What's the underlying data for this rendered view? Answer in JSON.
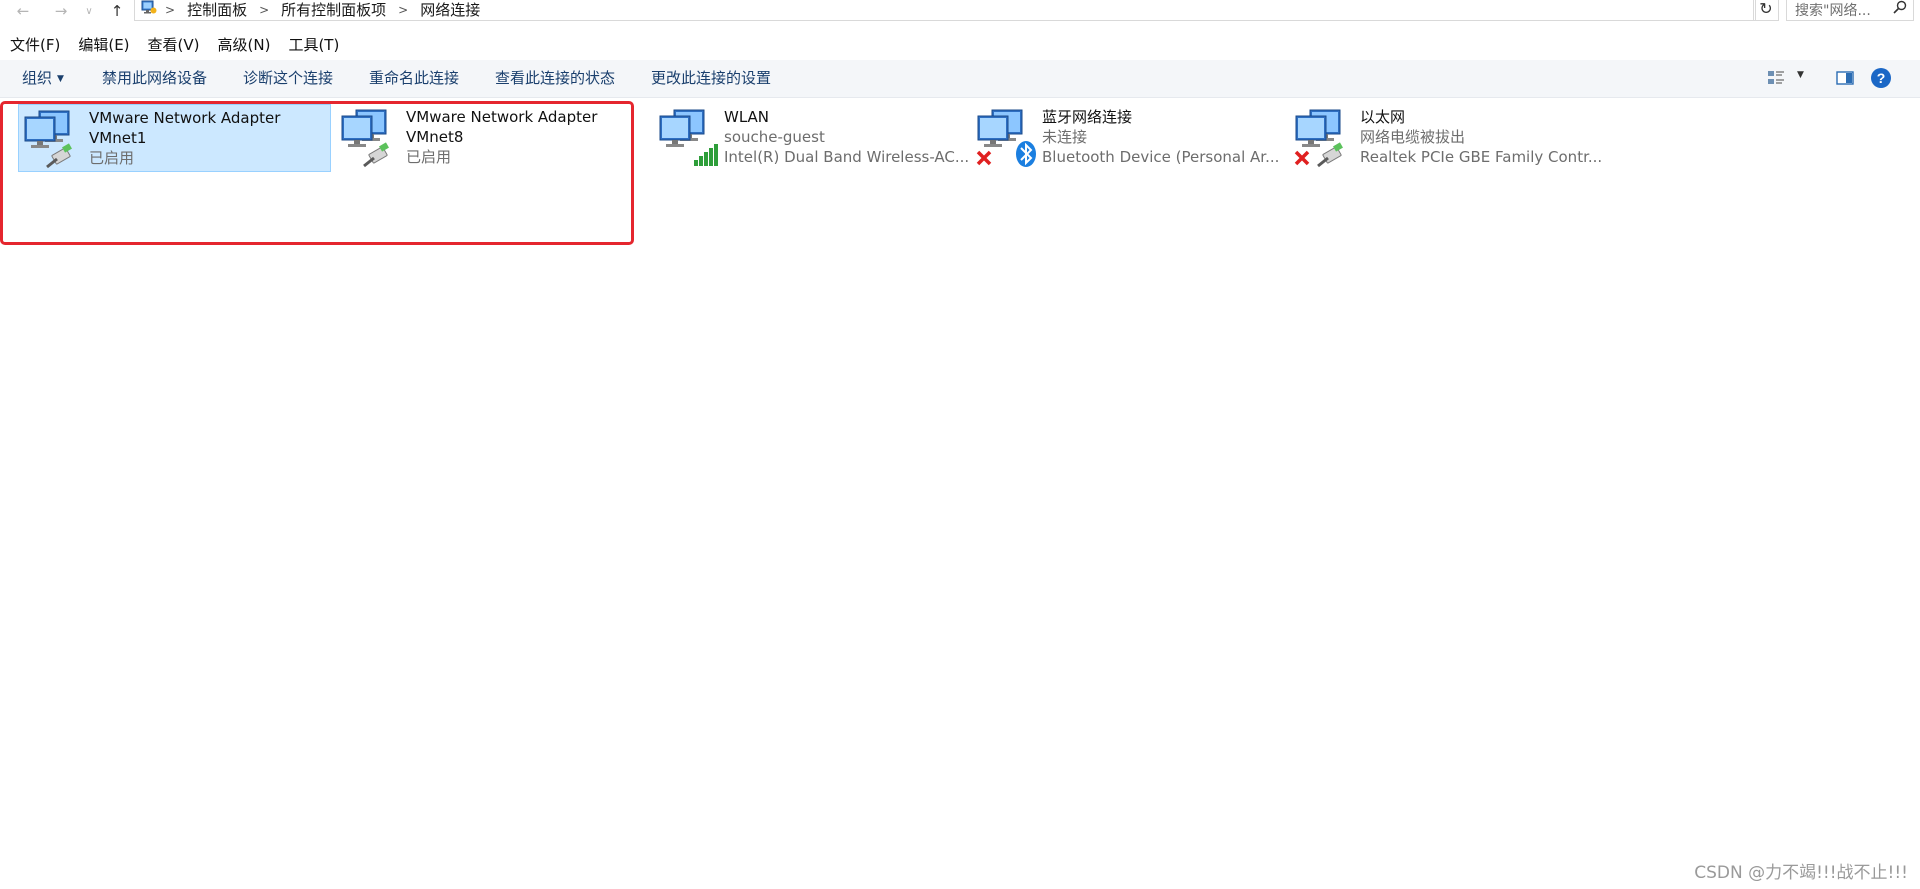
{
  "breadcrumb": [
    "控制面板",
    "所有控制面板项",
    "网络连接"
  ],
  "search": {
    "placeholder": "搜索\"网络..."
  },
  "menu": [
    "文件(F)",
    "编辑(E)",
    "查看(V)",
    "高级(N)",
    "工具(T)"
  ],
  "commands": {
    "organize": "组织",
    "disable": "禁用此网络设备",
    "diagnose": "诊断这个连接",
    "rename": "重命名此连接",
    "view_status": "查看此连接的状态",
    "change_settings": "更改此连接的设置",
    "help": "?"
  },
  "connections": [
    {
      "name": "VMware Network Adapter",
      "name2": "VMnet1",
      "status": "已启用",
      "device": ""
    },
    {
      "name": "VMware Network Adapter",
      "name2": "VMnet8",
      "status": "已启用",
      "device": ""
    },
    {
      "name": "WLAN",
      "name2": "",
      "status": "souche-guest",
      "device": "Intel(R) Dual Band Wireless-AC..."
    },
    {
      "name": "蓝牙网络连接",
      "name2": "",
      "status": "未连接",
      "device": "Bluetooth Device (Personal Ar..."
    },
    {
      "name": "以太网",
      "name2": "",
      "status": "网络电缆被拔出",
      "device": "Realtek PCIe GBE Family Contr..."
    }
  ],
  "watermark": "CSDN @力不竭!!!战不止!!!",
  "colors": {
    "selection": "#cce8ff",
    "highlight": "#e5262e",
    "command_text": "#1a3f6d"
  }
}
